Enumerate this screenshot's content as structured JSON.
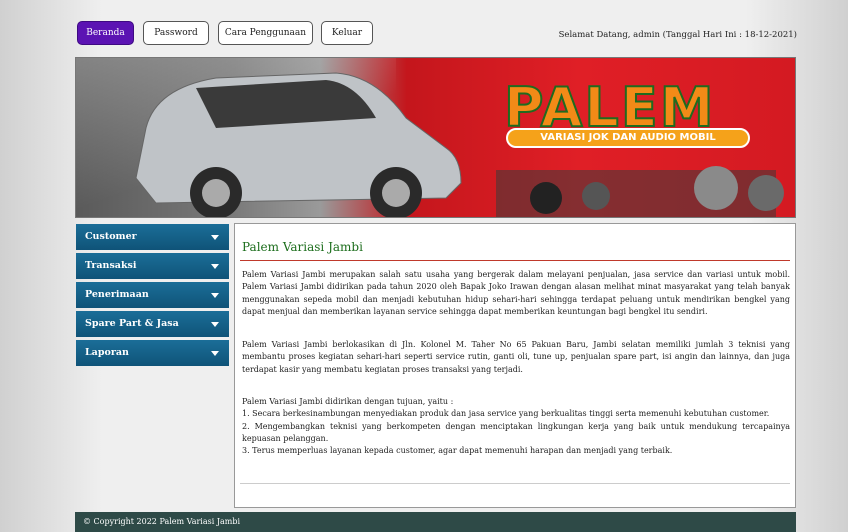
{
  "nav": {
    "buttons": [
      {
        "label": "Beranda"
      },
      {
        "label": "Password"
      },
      {
        "label": "Cara Penggunaan"
      },
      {
        "label": "Keluar"
      }
    ],
    "welcome": "Selamat Datang, admin (Tanggal Hari Ini : 18-12-2021)"
  },
  "banner": {
    "logo_text": "PALEM",
    "logo_subtitle": "VARIASI JOK DAN AUDIO MOBIL"
  },
  "sidebar": {
    "items": [
      {
        "label": "Customer"
      },
      {
        "label": "Transaksi"
      },
      {
        "label": "Penerimaan"
      },
      {
        "label": "Spare Part & Jasa"
      },
      {
        "label": "Laporan"
      }
    ]
  },
  "content": {
    "title": "Palem Variasi Jambi",
    "p1": "Palem Variasi Jambi merupakan salah satu usaha yang bergerak dalam melayani penjualan, jasa service dan variasi untuk mobil. Palem Variasi Jambi didirikan pada tahun 2020 oleh Bapak Joko Irawan dengan alasan melihat minat masyarakat yang telah banyak menggunakan sepeda mobil dan menjadi kebutuhan hidup sehari-hari sehingga terdapat peluang untuk mendirikan bengkel yang dapat menjual dan memberikan layanan service sehingga dapat memberikan keuntungan bagi bengkel itu sendiri.",
    "p2": "Palem Variasi Jambi berlokasikan di Jln. Kolonel M. Taher No 65 Pakuan Baru, Jambi selatan memiliki jumlah 3 teknisi yang membantu proses kegiatan sehari-hari seperti service rutin, ganti oli, tune up, penjualan spare part, isi angin dan lainnya, dan juga terdapat kasir yang membatu kegiatan proses transaksi yang terjadi.",
    "p3_intro": "Palem Variasi Jambi didirikan dengan tujuan, yaitu :",
    "p3_item1": "1. Secara berkesinambungan menyediakan produk dan jasa service yang berkualitas tinggi serta memenuhi kebutuhan customer.",
    "p3_item2": "2. Mengembangkan teknisi yang berkompeten dengan menciptakan lingkungan kerja yang baik untuk mendukung tercapainya kepuasan pelanggan.",
    "p3_item3": "3. Terus memperluas layanan kepada customer, agar dapat memenuhi harapan dan menjadi yang terbaik."
  },
  "footer": {
    "text": "© Copyright 2022 Palem Variasi Jambi"
  },
  "colors": {
    "nav_active": "#5b13b3",
    "sidebar": "#11587f",
    "title": "#1d6e1d",
    "title_rule": "#c0392b",
    "footer": "#2e4a47",
    "banner_red": "#e01f26"
  }
}
